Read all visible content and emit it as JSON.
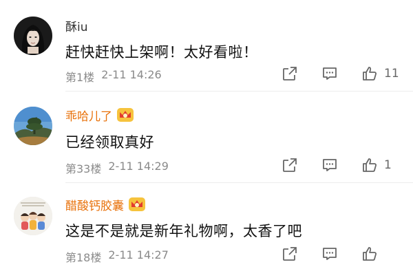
{
  "colors": {
    "vip_name": "#e8710a",
    "text": "#111111",
    "meta": "#8a8a8a",
    "icon": "#666666",
    "divider": "#ececec"
  },
  "comments": [
    {
      "username": "酥iu",
      "vip": false,
      "content": "赶快赶快上架啊！太好看啦！",
      "floor": "第1楼",
      "time": "2-11 14:26",
      "likes": "11",
      "avatar_icon": "girl-portrait"
    },
    {
      "username": "乖哈儿了",
      "vip": true,
      "content": "已经领取真好",
      "floor": "第33楼",
      "time": "2-11 14:29",
      "likes": "1",
      "avatar_icon": "mountain-landscape"
    },
    {
      "username": "醋酸钙胶囊",
      "vip": true,
      "content": "这是不是就是新年礼物啊，太香了吧",
      "floor": "第18楼",
      "time": "2-11 14:27",
      "likes": "",
      "avatar_icon": "cartoon-figures"
    }
  ],
  "icons": {
    "share": "share-icon",
    "reply": "comment-icon",
    "like": "thumbs-up-icon",
    "vip": "crown-badge-icon"
  }
}
